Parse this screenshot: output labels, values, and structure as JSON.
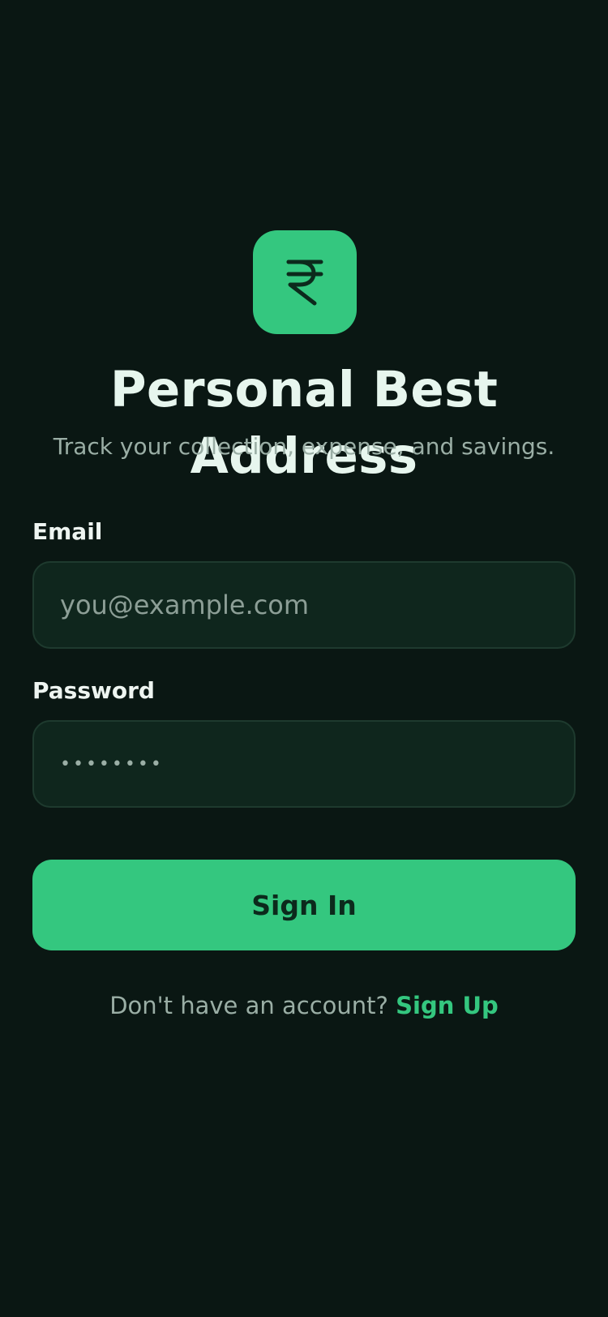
{
  "app": {
    "title": "Personal Best Address",
    "subtitle": "Track your collection, expense, and savings.",
    "logo_icon": "rupee-icon",
    "accent_color": "#34c77f",
    "background_color": "#0a1713"
  },
  "form": {
    "email": {
      "label": "Email",
      "placeholder": "you@example.com",
      "value": ""
    },
    "password": {
      "label": "Password",
      "value": "••••••••"
    },
    "submit_label": "Sign In"
  },
  "footer": {
    "prompt": "Don't have an account?",
    "link_label": "Sign Up"
  }
}
